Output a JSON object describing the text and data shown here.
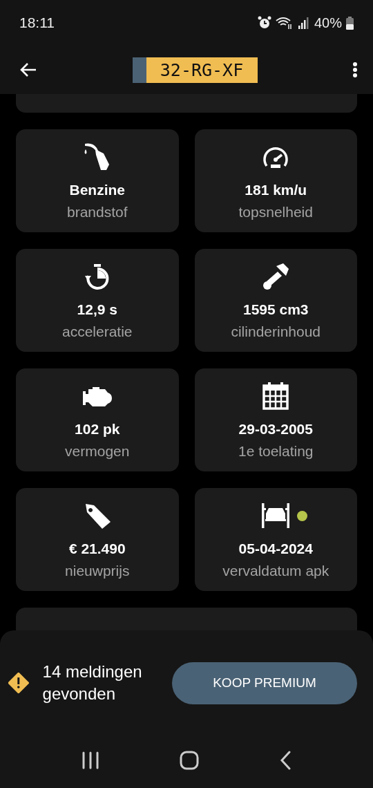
{
  "status_bar": {
    "time": "18:11",
    "battery": "40%"
  },
  "app_bar": {
    "plate": "32-RG-XF"
  },
  "stats": [
    {
      "kind": "fuel",
      "value": "Benzine",
      "label": "brandstof"
    },
    {
      "kind": "speed",
      "value": "181 km/u",
      "label": "topsnelheid"
    },
    {
      "kind": "acceleration",
      "value": "12,9 s",
      "label": "acceleratie"
    },
    {
      "kind": "displacement",
      "value": "1595 cm3",
      "label": "cilinderinhoud"
    },
    {
      "kind": "power",
      "value": "102 pk",
      "label": "vermogen"
    },
    {
      "kind": "date",
      "value": "29-03-2005",
      "label": "1e toelating"
    },
    {
      "kind": "price",
      "value": "€ 21.490",
      "label": "nieuwprijs"
    },
    {
      "kind": "inspection",
      "value": "05-04-2024",
      "label": "vervaldatum apk",
      "color": "#b5c44a"
    }
  ],
  "bottom_sheet": {
    "message": "14 meldingen gevonden",
    "button": "KOOP PREMIUM"
  }
}
